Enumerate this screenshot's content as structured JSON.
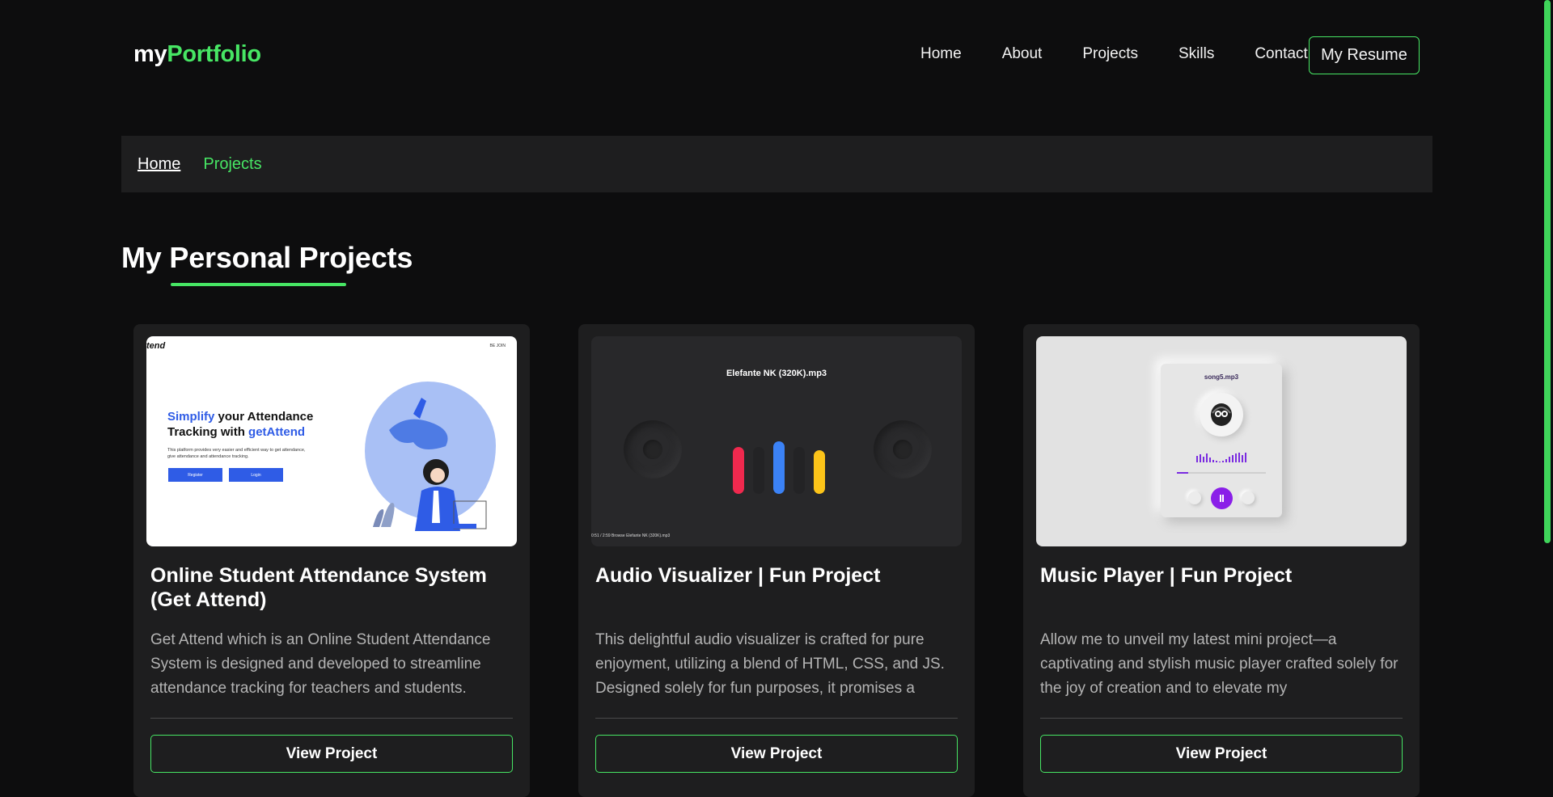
{
  "nav": {
    "logo_prefix": "my",
    "logo_main": "Portfolio",
    "links": [
      "Home",
      "About",
      "Projects",
      "Skills",
      "Contact"
    ],
    "resume_label": "My Resume"
  },
  "breadcrumb": {
    "home": "Home",
    "current": "Projects"
  },
  "section": {
    "title": "My Personal Projects"
  },
  "colors": {
    "accent": "#47e664",
    "background": "#0d0d0e",
    "card": "#1e1e1f"
  },
  "cards": [
    {
      "title": "Online Student Attendance System (Get Attend)",
      "description": "Get Attend which is an Online Student Attendance System is designed and developed to streamline attendance tracking for teachers and students.",
      "button": "View Project",
      "thumb": {
        "logo": "tend",
        "corner": "BE JOIN",
        "heading_blue1": "Simplify",
        "heading_mid": " your Attendance",
        "heading_line2": "Tracking with ",
        "heading_blue2": "getAttend",
        "paragraph": "This platform provides very easier and efficient way to get attendance, give attendance and attendance tracking.",
        "btn1": "Register",
        "btn2": "Login"
      }
    },
    {
      "title": "Audio Visualizer | Fun Project",
      "description": "This delightful audio visualizer is crafted for pure enjoyment, utilizing a blend of HTML, CSS, and JS. Designed solely for fun purposes, it promises a",
      "button": "View Project",
      "thumb": {
        "track": "Elefante NK (320K).mp3",
        "footer": "0:51 / 2:59   Browse   Elefante NK (320K).mp3"
      }
    },
    {
      "title": "Music Player | Fun Project",
      "description": "Allow me to unveil my latest mini project—a captivating and stylish music player crafted solely for the joy of creation and to elevate my",
      "button": "View Project",
      "thumb": {
        "song": "song5.mp3"
      }
    }
  ]
}
